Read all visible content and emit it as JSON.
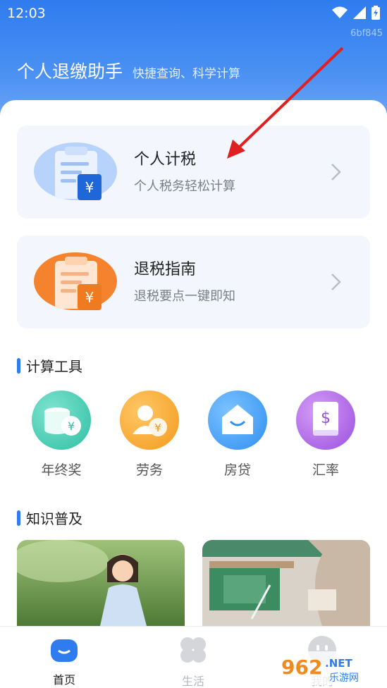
{
  "status": {
    "time": "12:03",
    "watermark": "6bf845"
  },
  "header": {
    "title": "个人退缴助手",
    "subtitle": "快捷查询、科学计算"
  },
  "cards": [
    {
      "title": "个人计税",
      "subtitle": "个人税务轻松计算",
      "icon": "tax-calculator-icon",
      "color": "#2f7cf0"
    },
    {
      "title": "退税指南",
      "subtitle": "退税要点一键即知",
      "icon": "refund-guide-icon",
      "color": "#f5832d"
    }
  ],
  "tools_section": {
    "label": "计算工具"
  },
  "tools": [
    {
      "label": "年终奖",
      "icon": "coins-yen-icon",
      "color": "#3fc7b0"
    },
    {
      "label": "劳务",
      "icon": "person-yen-icon",
      "color": "#f5a330"
    },
    {
      "label": "房贷",
      "icon": "house-icon",
      "color": "#3a9df5"
    },
    {
      "label": "汇率",
      "icon": "dollar-book-icon",
      "color": "#a35de0"
    }
  ],
  "knowledge_section": {
    "label": "知识普及"
  },
  "tabbar": {
    "items": [
      {
        "label": "首页",
        "active": true
      },
      {
        "label": "生活",
        "active": false
      },
      {
        "label": "我的",
        "active": false
      }
    ]
  },
  "overlay_logo": {
    "text": "962",
    "suffix": ".NET",
    "sub": "乐游网"
  }
}
